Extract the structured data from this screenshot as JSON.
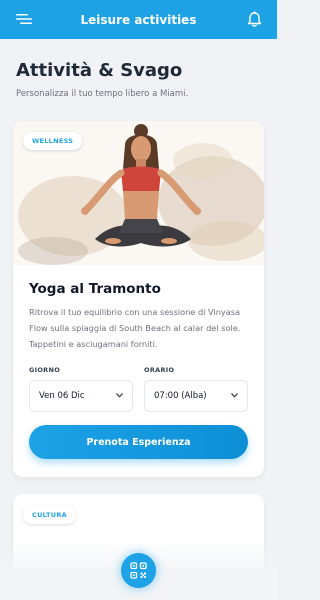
{
  "header": {
    "title": "Leisure activities",
    "menu_icon": "menu-icon",
    "bell_icon": "bell-icon"
  },
  "page": {
    "title": "Attività & Svago",
    "subtitle": "Personalizza il tuo tempo libero a Miami."
  },
  "activity_card": {
    "badge": "WELLNESS",
    "image_icon": "yoga-woman-image",
    "title": "Yoga al Tramonto",
    "description": "Ritrova il tuo equilibrio con una sessione di Vinyasa Flow sulla spiaggia di South Beach al calar del sole. Tappetini e asciugamani forniti.",
    "date_label": "GIORNO",
    "date_value": "Ven 06 Dic",
    "time_label": "ORARIO",
    "time_value": "07:00 (Alba)",
    "cta_label": "Prenota Esperienza"
  },
  "next_card": {
    "badge": "CULTURA"
  },
  "fab": {
    "icon": "qr-code-icon"
  },
  "colors": {
    "accent": "#1ea2e6",
    "background": "#f0f2f5",
    "text_primary": "#111827",
    "text_muted": "#6b7280"
  }
}
